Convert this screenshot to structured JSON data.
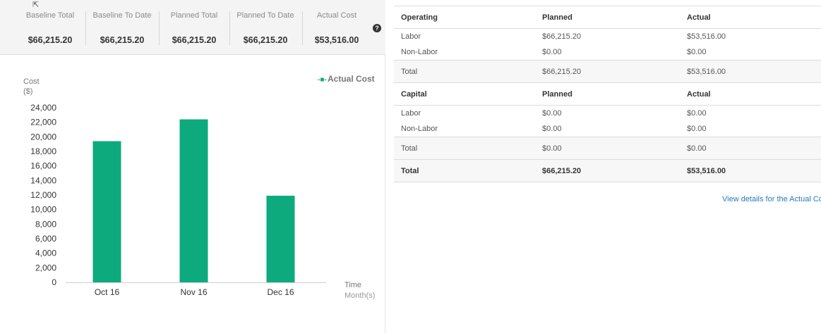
{
  "summary": {
    "kpis": [
      {
        "label": "Baseline Total",
        "value": "$66,215.20"
      },
      {
        "label": "Baseline To Date",
        "value": "$66,215.20"
      },
      {
        "label": "Planned Total",
        "value": "$66,215.20"
      },
      {
        "label": "Planned To Date",
        "value": "$66,215.20"
      },
      {
        "label": "Actual Cost",
        "value": "$53,516.00"
      }
    ],
    "help_glyph": "?"
  },
  "chart_data": {
    "type": "bar",
    "categories": [
      "Oct 16",
      "Nov 16",
      "Dec 16"
    ],
    "series": [
      {
        "name": "Actual Cost",
        "values": [
          19400,
          22400,
          11900
        ],
        "color": "#0daa7e"
      }
    ],
    "ylabel_line1": "Cost",
    "ylabel_line2": "($)",
    "xlabel_line1": "Time",
    "xlabel_line2": "Month(s)",
    "ylim": [
      0,
      24000
    ],
    "yticks": [
      0,
      2000,
      4000,
      6000,
      8000,
      10000,
      12000,
      14000,
      16000,
      18000,
      20000,
      22000,
      24000
    ],
    "ytick_labels": [
      "0",
      "2,000",
      "4,000",
      "6,000",
      "8,000",
      "10,000",
      "12,000",
      "14,000",
      "16,000",
      "18,000",
      "20,000",
      "22,000",
      "24,000"
    ],
    "legend": "top-right",
    "legend_marker": "-■-",
    "grid": false
  },
  "table": {
    "operating": {
      "header": [
        "Operating",
        "Planned",
        "Actual"
      ],
      "rows": [
        [
          "Labor",
          "$66,215.20",
          "$53,516.00"
        ],
        [
          "Non-Labor",
          "$0.00",
          "$0.00"
        ]
      ],
      "total": [
        "Total",
        "$66,215.20",
        "$53,516.00"
      ]
    },
    "capital": {
      "header": [
        "Capital",
        "Planned",
        "Actual"
      ],
      "rows": [
        [
          "Labor",
          "$0.00",
          "$0.00"
        ],
        [
          "Non-Labor",
          "$0.00",
          "$0.00"
        ]
      ],
      "total": [
        "Total",
        "$0.00",
        "$0.00"
      ]
    },
    "grand_total": [
      "Total",
      "$66,215.20",
      "$53,516.00"
    ]
  },
  "details_link": "View details for the Actual Cost"
}
